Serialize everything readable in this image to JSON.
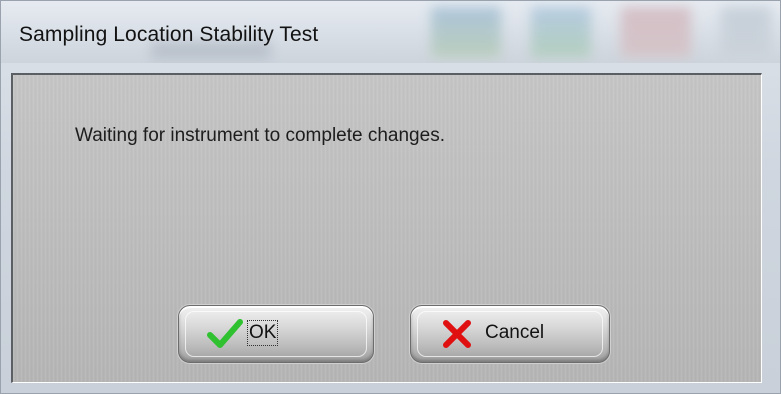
{
  "window": {
    "title": "Sampling Location Stability Test"
  },
  "dialog": {
    "message": "Waiting for instrument to complete changes."
  },
  "buttons": {
    "ok": {
      "label": "OK",
      "icon": "checkmark-icon",
      "icon_color": "#2fc12f"
    },
    "cancel": {
      "label": "Cancel",
      "icon": "x-icon",
      "icon_color": "#e01010"
    }
  }
}
